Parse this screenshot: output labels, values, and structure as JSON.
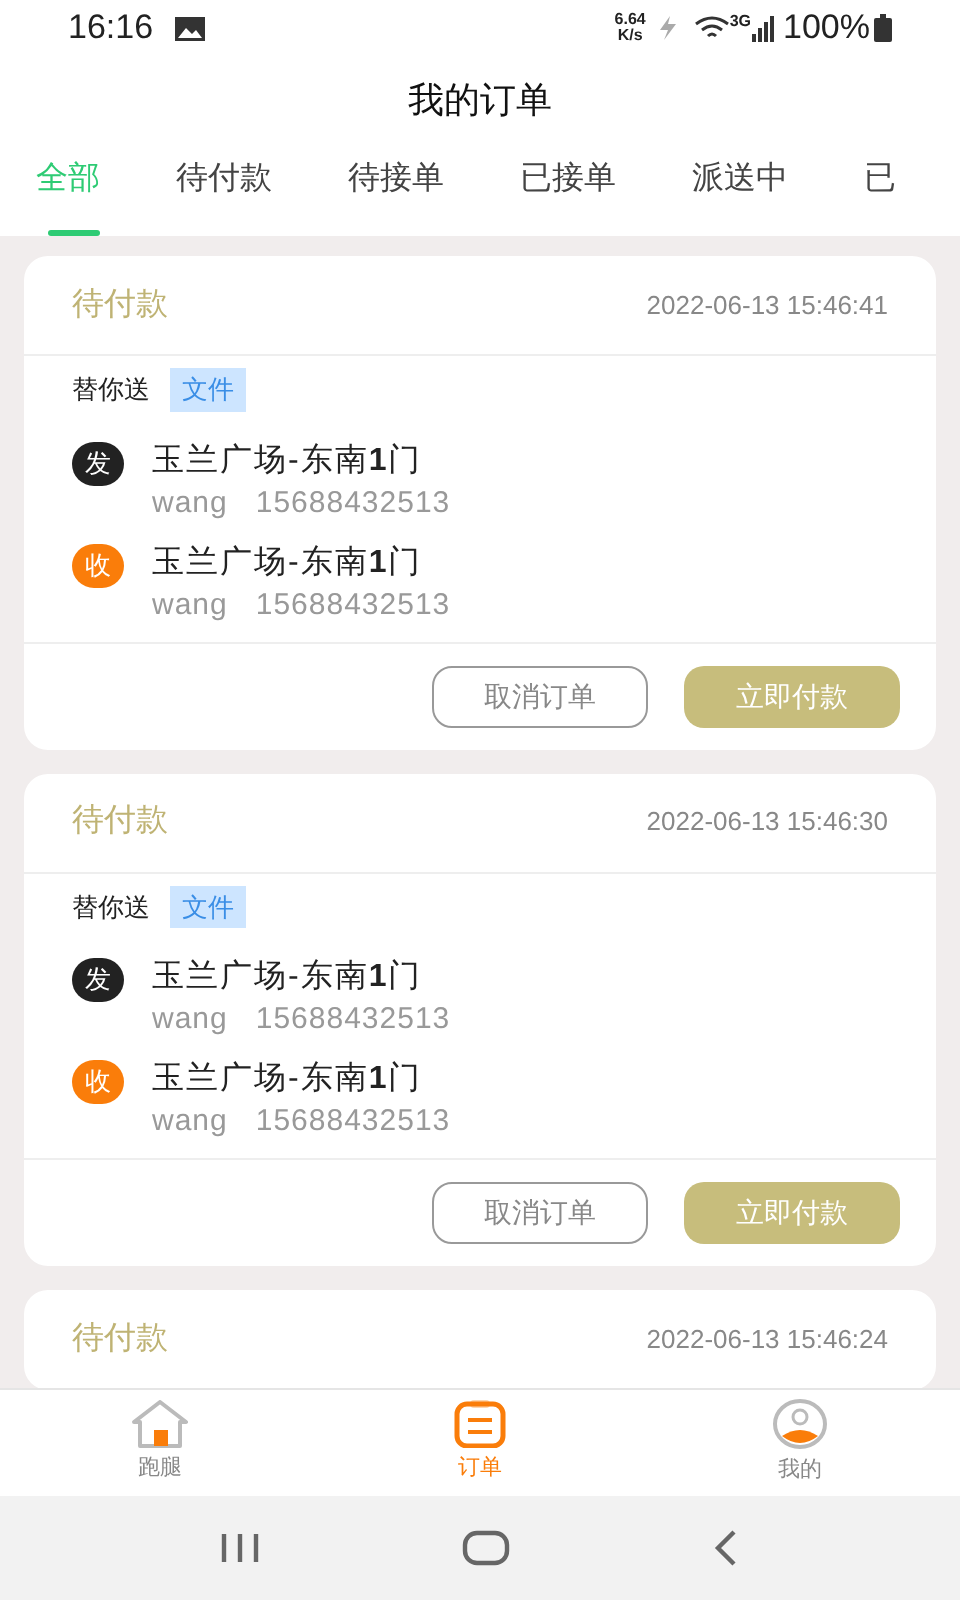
{
  "status_bar": {
    "time": "16:16",
    "speed": "6.64",
    "speed_unit": "K/s",
    "network": "3G",
    "battery": "100%"
  },
  "title": "我的订单",
  "tabs": [
    {
      "label": "全部",
      "selected": true
    },
    {
      "label": "待付款",
      "selected": false
    },
    {
      "label": "待接单",
      "selected": false
    },
    {
      "label": "已接单",
      "selected": false
    },
    {
      "label": "派送中",
      "selected": false
    },
    {
      "label": "已",
      "selected": false
    }
  ],
  "orders": [
    {
      "status": "待付款",
      "time": "2022-06-13 15:46:41",
      "service": "替你送",
      "category": "文件",
      "stops": [
        {
          "kind": "send",
          "badge": "发",
          "address": "玉兰广场-东南**1**门",
          "name": "wang",
          "phone": "15688432513"
        },
        {
          "kind": "receive",
          "badge": "收",
          "address": "玉兰广场-东南**1**门",
          "name": "wang",
          "phone": "15688432513"
        }
      ],
      "buttons": [
        {
          "kind": "outline",
          "label": "取消订单"
        },
        {
          "kind": "primary",
          "label": "立即付款"
        }
      ]
    },
    {
      "status": "待付款",
      "time": "2022-06-13 15:46:30",
      "service": "替你送",
      "category": "文件",
      "stops": [
        {
          "kind": "send",
          "badge": "发",
          "address": "玉兰广场-东南**1**门",
          "name": "wang",
          "phone": "15688432513"
        },
        {
          "kind": "receive",
          "badge": "收",
          "address": "玉兰广场-东南**1**门",
          "name": "wang",
          "phone": "15688432513"
        }
      ],
      "buttons": [
        {
          "kind": "outline",
          "label": "取消订单"
        },
        {
          "kind": "primary",
          "label": "立即付款"
        }
      ]
    },
    {
      "status": "待付款",
      "time": "2022-06-13 15:46:24"
    }
  ],
  "bottom_nav": [
    {
      "kind": "home",
      "label": "跑腿",
      "selected": false
    },
    {
      "kind": "orders",
      "label": "订单",
      "selected": true
    },
    {
      "kind": "profile",
      "label": "我的",
      "selected": false
    }
  ]
}
